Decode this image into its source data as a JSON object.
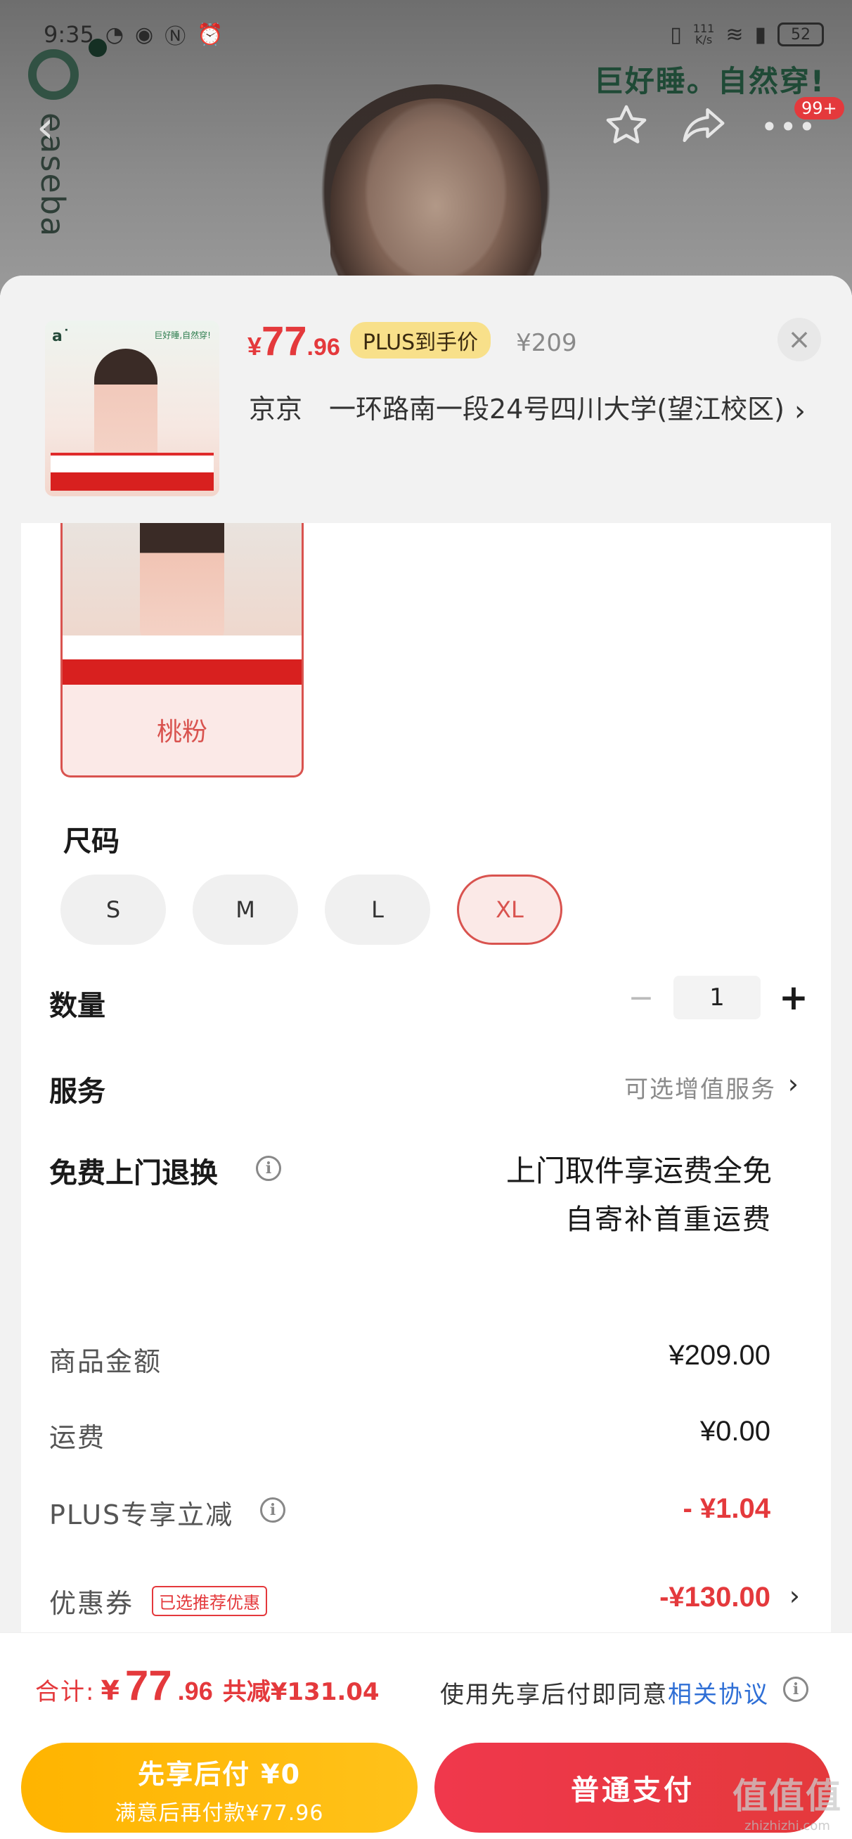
{
  "status_bar": {
    "time": "9:35",
    "net_speed_value": "111",
    "net_speed_unit": "K/s",
    "battery": "52"
  },
  "background": {
    "brand_text": "easeba",
    "slogan": "巨好睡。自然穿!",
    "more_badge": "99+"
  },
  "sheet": {
    "price": {
      "currency": "¥",
      "integer": "77",
      "decimal": ".96"
    },
    "plus_tag": "PLUS到手价",
    "original_price": "¥209",
    "address": "京京　一环路南一段24号四川大学(望江校区)",
    "thumb_slogan": "巨好睡,自然穿!"
  },
  "color": {
    "label": "桃粉"
  },
  "size": {
    "title": "尺码",
    "options": [
      {
        "label": "S",
        "selected": false
      },
      {
        "label": "M",
        "selected": false
      },
      {
        "label": "L",
        "selected": false
      },
      {
        "label": "XL",
        "selected": true
      }
    ]
  },
  "quantity": {
    "label": "数量",
    "value": "1",
    "minus": "−",
    "plus": "+"
  },
  "service": {
    "label": "服务",
    "value": "可选增值服务"
  },
  "return": {
    "label": "免费上门退换",
    "line1": "上门取件享运费全免",
    "line2": "自寄补首重运费"
  },
  "bill": {
    "goods_label": "商品金额",
    "goods_value": "¥209.00",
    "shipping_label": "运费",
    "shipping_value": "¥0.00",
    "plus_label": "PLUS专享立减",
    "plus_value": "- ¥1.04",
    "coupon_label": "优惠券",
    "coupon_tag": "已选推荐优惠",
    "coupon_value": "-¥130.00"
  },
  "footer": {
    "total_label": "合计:",
    "total_currency": "¥",
    "total_integer": "77",
    "total_decimal": ".96",
    "total_saved": "共减¥131.04",
    "agree_text": "使用先享后付即同意",
    "agree_link": "相关协议",
    "btn_later_title": "先享后付 ¥0",
    "btn_later_sub": "满意后再付款¥77.96",
    "btn_pay": "普通支付"
  },
  "watermark": {
    "big": "值值值",
    "small": "zhizhizhi.com"
  },
  "colors": {
    "accent": "#e4393c",
    "plus_tag": "#f8e08a",
    "later_btn": "#ffb400",
    "link": "#2f6fd6"
  },
  "icons": [
    "back-icon",
    "star-icon",
    "share-icon",
    "more-icon",
    "close-icon",
    "info-icon",
    "chevron-right-icon"
  ]
}
